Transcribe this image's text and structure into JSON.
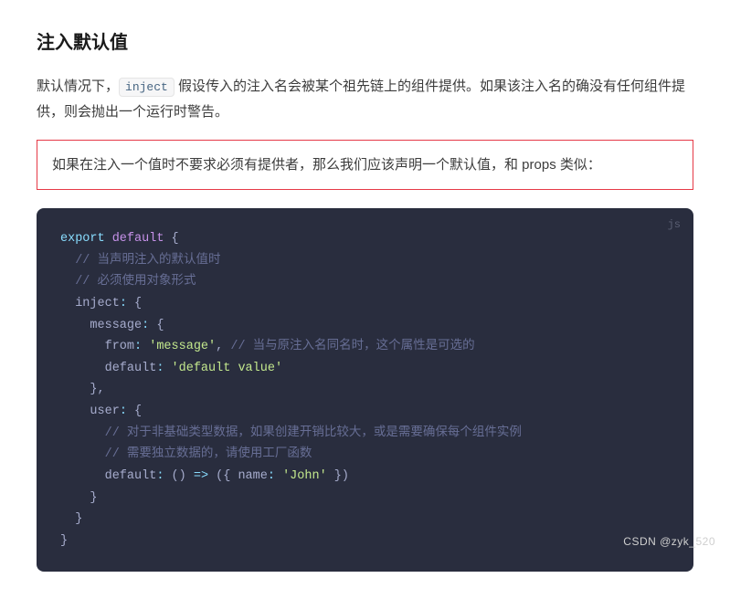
{
  "heading": "注入默认值",
  "paragraph": {
    "before_code": "默认情况下，",
    "inline_code": "inject",
    "after_code": " 假设传入的注入名会被某个祖先链上的组件提供。如果该注入名的确没有任何组件提供，则会抛出一个运行时警告。"
  },
  "highlight_text": "如果在注入一个值时不要求必须有提供者，那么我们应该声明一个默认值，和 props 类似：",
  "code_lang": "js",
  "code": {
    "l1_export": "export",
    "l1_default": " default",
    "l1_brace": " {",
    "l2_comment": "  // 当声明注入的默认值时",
    "l3_comment": "  // 必须使用对象形式",
    "l4_prop": "  inject",
    "l4_colon": ": ",
    "l4_brace": "{",
    "l5_prop": "    message",
    "l5_colon": ": ",
    "l5_brace": "{",
    "l6_prop": "      from",
    "l6_colon": ": ",
    "l6_str": "'message'",
    "l6_comma": ", ",
    "l6_comment": "// 当与原注入名同名时，这个属性是可选的",
    "l7_prop": "      default",
    "l7_colon": ": ",
    "l7_str": "'default value'",
    "l8_brace": "    },",
    "l9_prop": "    user",
    "l9_colon": ": ",
    "l9_brace": "{",
    "l10_comment": "      // 对于非基础类型数据，如果创建开销比较大，或是需要确保每个组件实例",
    "l11_comment": "      // 需要独立数据的，请使用工厂函数",
    "l12_prop": "      default",
    "l12_colon": ": ",
    "l12_fn": "() ",
    "l12_arrow": "=>",
    "l12_after": " ({ ",
    "l12_name": "name",
    "l12_colon2": ": ",
    "l12_str": "'John'",
    "l12_close": " })",
    "l13_brace": "    }",
    "l14_brace": "  }",
    "l15_brace": "}"
  },
  "watermark": "CSDN @zyk_520"
}
